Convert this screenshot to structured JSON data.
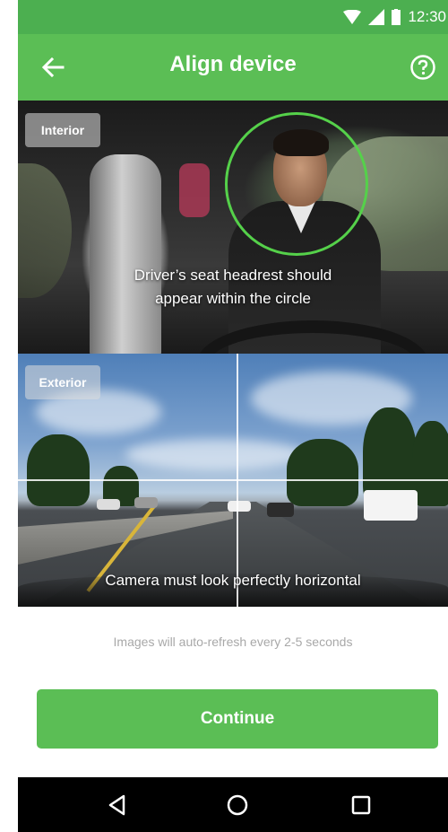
{
  "status_bar": {
    "time": "12:30",
    "icons": [
      "wifi-icon",
      "signal-icon",
      "battery-icon"
    ]
  },
  "header": {
    "title": "Align device",
    "back_icon": "arrow-left-icon",
    "help_icon": "help-circle-icon"
  },
  "interior": {
    "label": "Interior",
    "caption_line1": "Driver’s seat headrest should",
    "caption_line2": "appear within the circle"
  },
  "exterior": {
    "label": "Exterior",
    "caption": "Camera must look perfectly horizontal"
  },
  "note": "Images will auto-refresh every 2-5 seconds",
  "continue_label": "Continue",
  "nav": {
    "back_icon": "triangle-back-icon",
    "home_icon": "circle-home-icon",
    "recents_icon": "square-recents-icon"
  },
  "colors": {
    "primary": "#5bbe55",
    "status_bar": "#4caf50",
    "guide_circle": "#55d14a",
    "note_text": "#a8a8a8"
  }
}
